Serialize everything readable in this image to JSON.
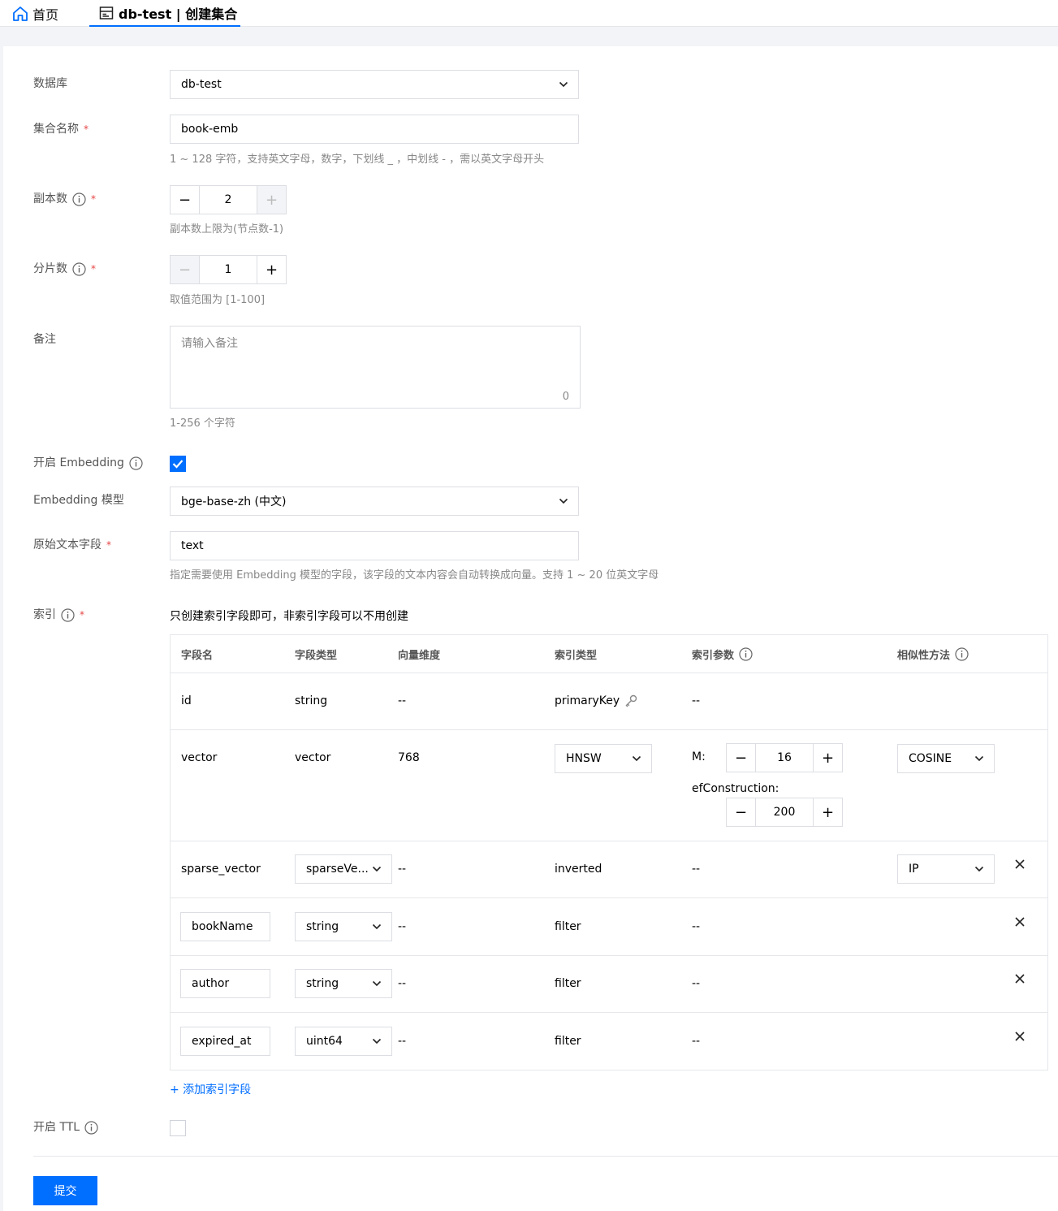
{
  "tabs": {
    "home": "首页",
    "active": "db-test | 创建集合"
  },
  "form": {
    "database": {
      "label": "数据库",
      "value": "db-test"
    },
    "collection_name": {
      "label": "集合名称",
      "required": "*",
      "value": "book-emb",
      "help": "1 ~ 128 字符，支持英文字母，数字，下划线 _ ，中划线 - ，需以英文字母开头"
    },
    "replicas": {
      "label": "副本数",
      "required": "*",
      "value": "2",
      "help": "副本数上限为(节点数-1)"
    },
    "shards": {
      "label": "分片数",
      "required": "*",
      "value": "1",
      "help": "取值范围为 [1-100]"
    },
    "remark": {
      "label": "备注",
      "placeholder": "请输入备注",
      "count": "0",
      "help": "1-256 个字符"
    },
    "embedding": {
      "label": "开启 Embedding",
      "checked": true
    },
    "embedding_model": {
      "label": "Embedding 模型",
      "value": "bge-base-zh (中文)"
    },
    "raw_text_field": {
      "label": "原始文本字段",
      "required": "*",
      "value": "text",
      "help": "指定需要使用 Embedding 模型的字段，该字段的文本内容会自动转换成向量。支持 1 ~ 20 位英文字母"
    },
    "index": {
      "label": "索引",
      "required": "*",
      "hint": "只创建索引字段即可，非索引字段可以不用创建"
    },
    "ttl": {
      "label": "开启 TTL",
      "checked": false
    }
  },
  "table": {
    "headers": {
      "field_name": "字段名",
      "field_type": "字段类型",
      "dimension": "向量维度",
      "index_type": "索引类型",
      "index_params": "索引参数",
      "similarity": "相似性方法"
    },
    "rows": [
      {
        "name": "id",
        "type": "string",
        "dim": "--",
        "index_type": "primaryKey",
        "params": "--",
        "similarity": ""
      },
      {
        "name": "vector",
        "type": "vector",
        "dim": "768",
        "index_type": "HNSW",
        "param_m_label": "M:",
        "param_m": "16",
        "param_ef_label": "efConstruction:",
        "param_ef": "200",
        "similarity": "COSINE"
      },
      {
        "name": "sparse_vector",
        "type": "sparseVe...",
        "dim": "--",
        "index_type": "inverted",
        "params": "--",
        "similarity": "IP"
      },
      {
        "name": "bookName",
        "type": "string",
        "dim": "--",
        "index_type": "filter",
        "params": "--"
      },
      {
        "name": "author",
        "type": "string",
        "dim": "--",
        "index_type": "filter",
        "params": "--"
      },
      {
        "name": "expired_at",
        "type": "uint64",
        "dim": "--",
        "index_type": "filter",
        "params": "--"
      }
    ],
    "add_field": "+ 添加索引字段"
  },
  "submit": "提交",
  "colors": {
    "accent": "#006eff",
    "required": "#e54545"
  }
}
